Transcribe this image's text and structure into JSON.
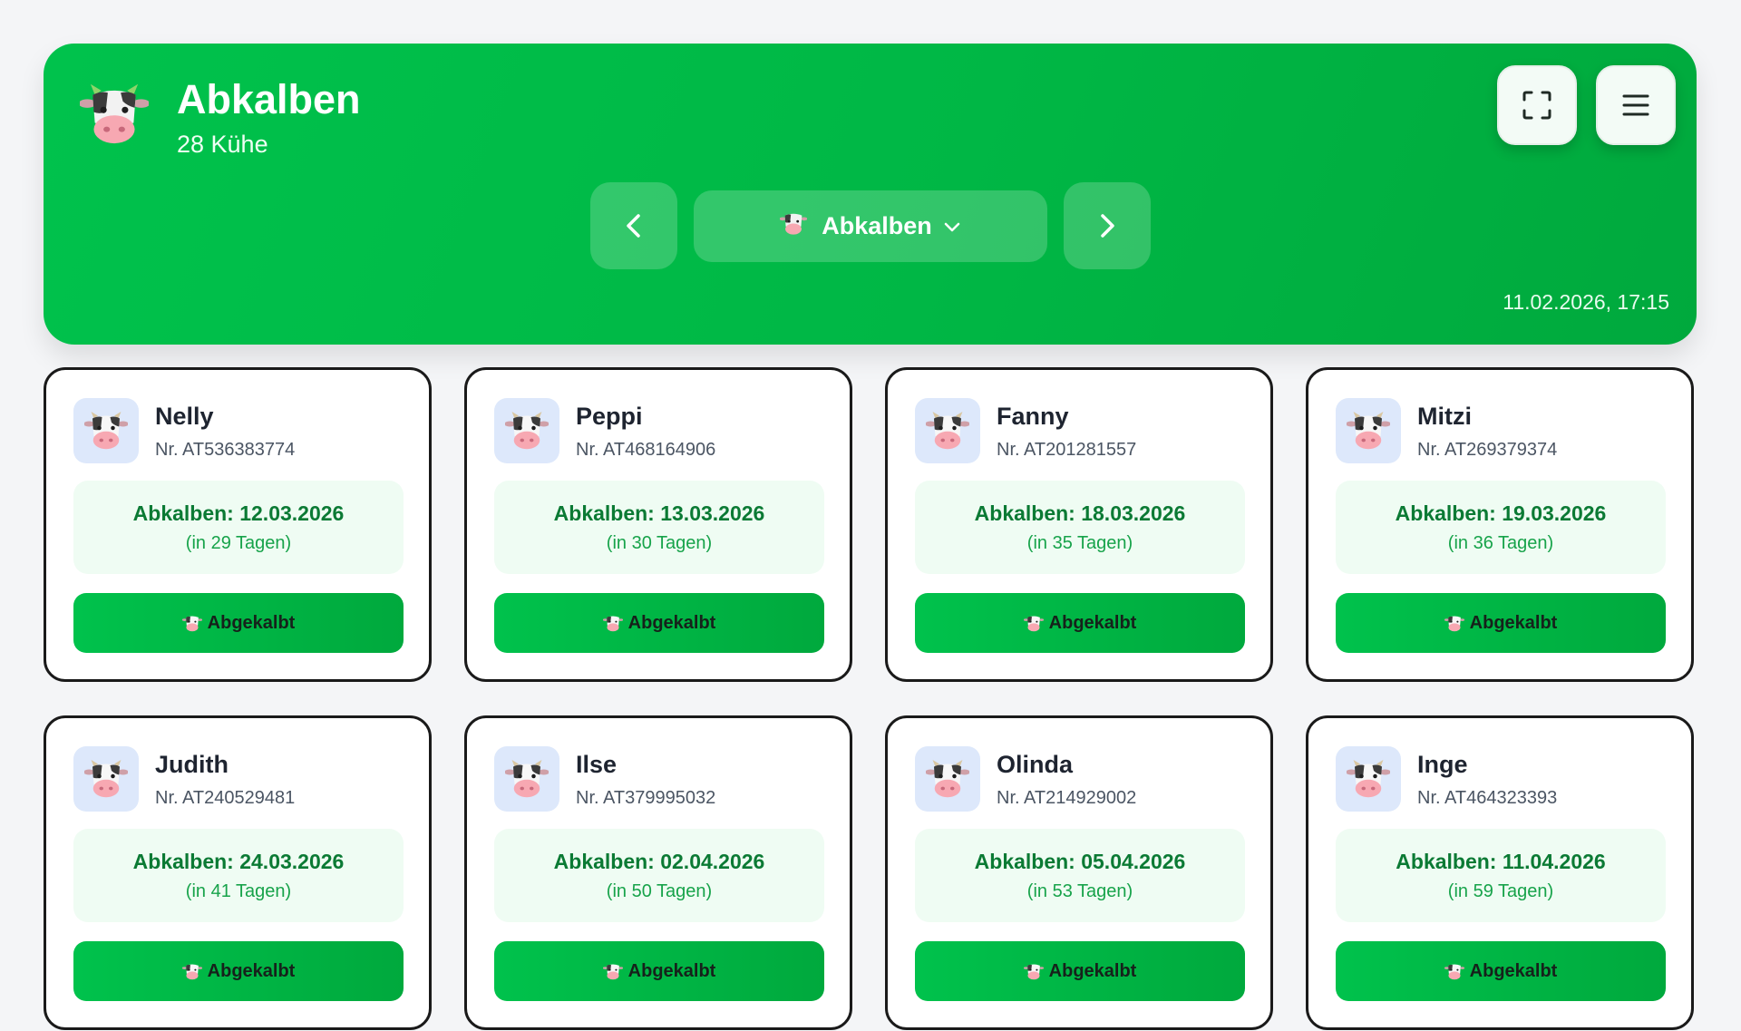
{
  "header": {
    "title": "Abkalben",
    "subtitle": "28 Kühe",
    "logo_icon": "cow-icon",
    "fullscreen_icon": "fullscreen-icon",
    "menu_icon": "hamburger-menu-icon",
    "prev_icon": "chevron-left-icon",
    "next_icon": "chevron-right-icon",
    "dropdown": {
      "label": "Abkalben",
      "icon": "cow-icon",
      "caret_icon": "chevron-down-icon"
    },
    "datetime": "11.02.2026, 17:15"
  },
  "colors": {
    "header_green": "#00b745",
    "info_bg": "#effcf3",
    "due_text": "#0b7a34",
    "days_text": "#17a34a",
    "avatar_bg": "#dde8fb"
  },
  "cards": [
    {
      "name": "Nelly",
      "nr": "Nr. AT536383774",
      "due": "Abkalben: 12.03.2026",
      "days": "(in 29 Tagen)",
      "action": "Abgekalbt"
    },
    {
      "name": "Peppi",
      "nr": "Nr. AT468164906",
      "due": "Abkalben: 13.03.2026",
      "days": "(in 30 Tagen)",
      "action": "Abgekalbt"
    },
    {
      "name": "Fanny",
      "nr": "Nr. AT201281557",
      "due": "Abkalben: 18.03.2026",
      "days": "(in 35 Tagen)",
      "action": "Abgekalbt"
    },
    {
      "name": "Mitzi",
      "nr": "Nr. AT269379374",
      "due": "Abkalben: 19.03.2026",
      "days": "(in 36 Tagen)",
      "action": "Abgekalbt"
    },
    {
      "name": "Judith",
      "nr": "Nr. AT240529481",
      "due": "Abkalben: 24.03.2026",
      "days": "(in 41 Tagen)",
      "action": "Abgekalbt"
    },
    {
      "name": "Ilse",
      "nr": "Nr. AT379995032",
      "due": "Abkalben: 02.04.2026",
      "days": "(in 50 Tagen)",
      "action": "Abgekalbt"
    },
    {
      "name": "Olinda",
      "nr": "Nr. AT214929002",
      "due": "Abkalben: 05.04.2026",
      "days": "(in 53 Tagen)",
      "action": "Abgekalbt"
    },
    {
      "name": "Inge",
      "nr": "Nr. AT464323393",
      "due": "Abkalben: 11.04.2026",
      "days": "(in 59 Tagen)",
      "action": "Abgekalbt"
    }
  ]
}
